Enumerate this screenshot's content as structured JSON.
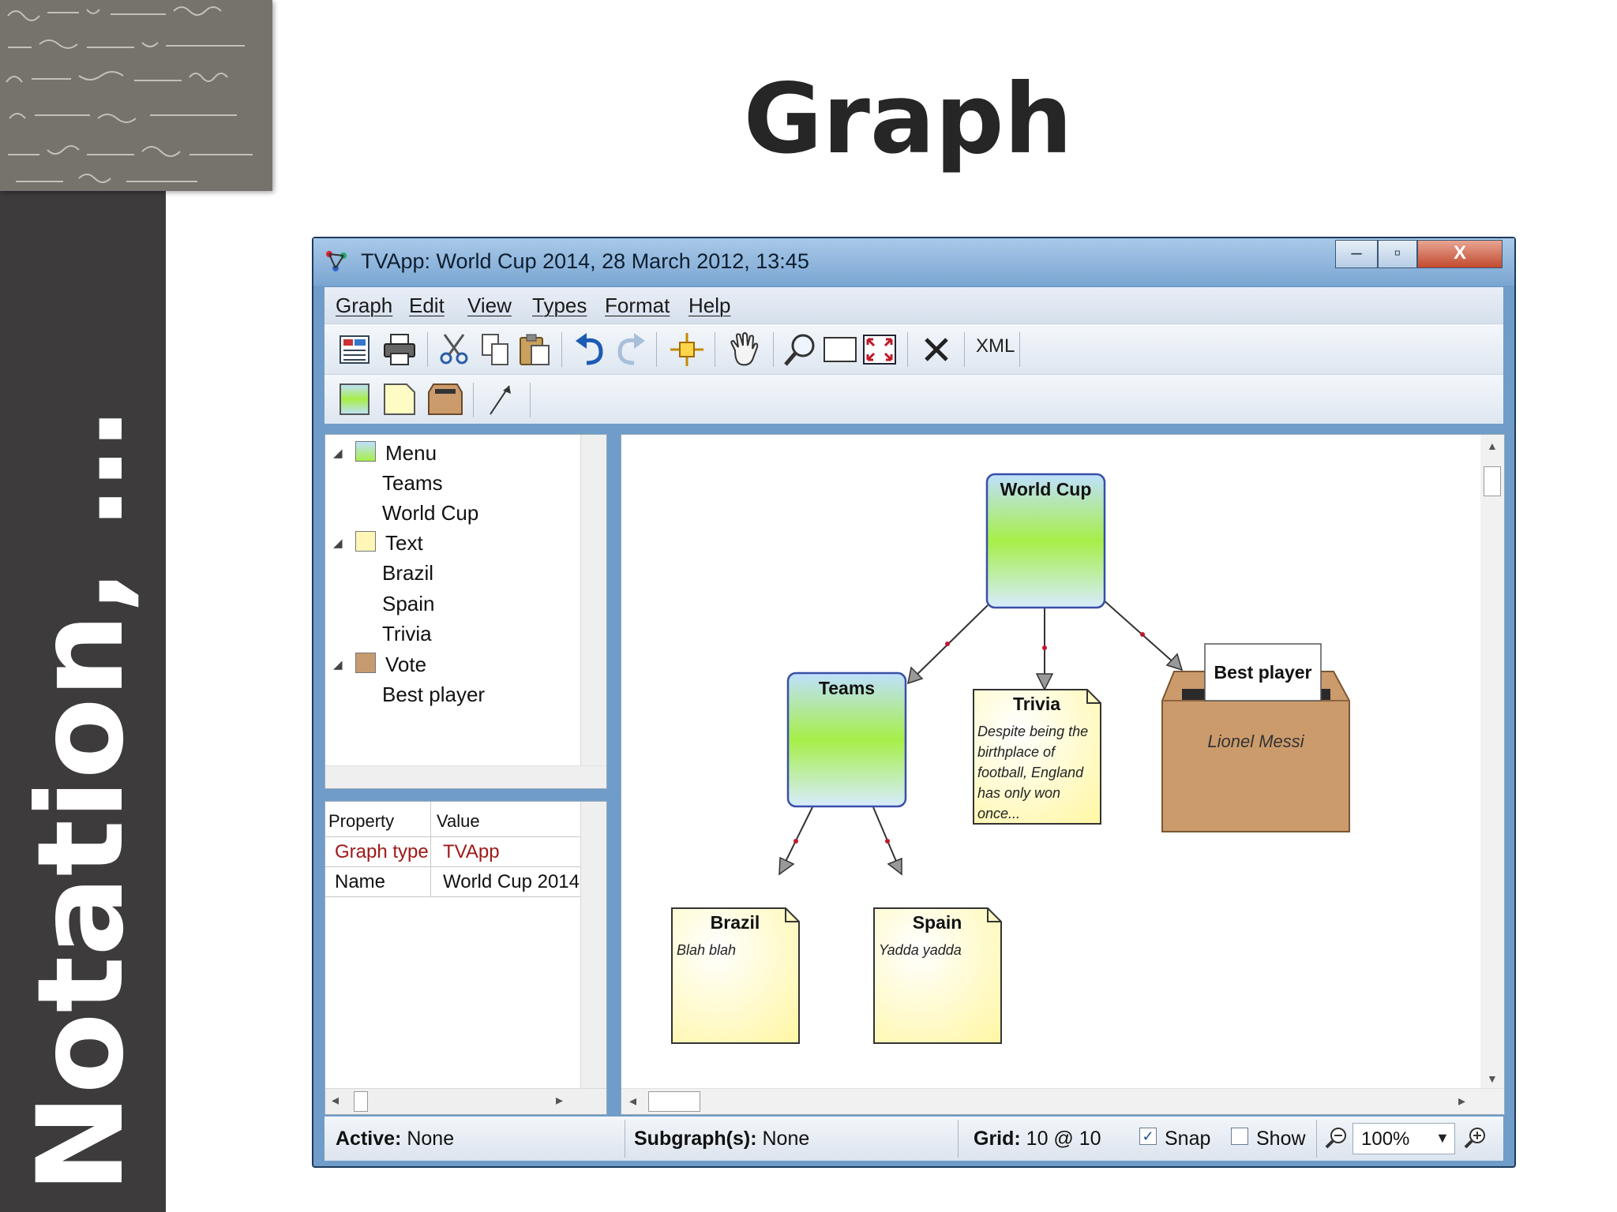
{
  "slide": {
    "title": "Graph",
    "side_title": "Notation, …"
  },
  "window": {
    "title": "TVApp: World Cup 2014, 28 March 2012, 13:45",
    "minimize_glyph": "–",
    "maximize_glyph": "▫",
    "close_glyph": "X"
  },
  "menu": {
    "items": [
      "Graph",
      "Edit",
      "View",
      "Types",
      "Format",
      "Help"
    ]
  },
  "toolbar": {
    "xml_label": "XML",
    "icons": [
      "grid-icon",
      "print-icon",
      "cut-icon",
      "copy-icon",
      "paste-icon",
      "undo-icon",
      "redo-icon",
      "move-icon",
      "pan-hand-icon",
      "zoom-icon",
      "select-rect-icon",
      "fit-icon",
      "delete-icon"
    ],
    "row2_icons": [
      "menu-type-icon",
      "text-type-icon",
      "vote-type-icon",
      "connector-icon"
    ]
  },
  "tree": {
    "groups": [
      {
        "label": "Menu",
        "icon": "menu-type-icon",
        "color": "#9fe06a",
        "children": [
          "Teams",
          "World Cup"
        ]
      },
      {
        "label": "Text",
        "icon": "text-type-icon",
        "color": "#fff6b8",
        "children": [
          "Brazil",
          "Spain",
          "Trivia"
        ]
      },
      {
        "label": "Vote",
        "icon": "vote-type-icon",
        "color": "#c79b70",
        "children": [
          "Best player"
        ]
      }
    ]
  },
  "properties": {
    "headers": [
      "Property",
      "Value"
    ],
    "rows": [
      {
        "property": "Graph type",
        "value": "TVApp",
        "highlight": "#a01818"
      },
      {
        "property": "Name",
        "value": "World Cup 2014",
        "highlight": "#111111"
      }
    ]
  },
  "graph": {
    "nodes": {
      "world_cup": {
        "label": "World Cup",
        "kind": "menu"
      },
      "teams": {
        "label": "Teams",
        "kind": "menu"
      },
      "trivia": {
        "label": "Trivia",
        "kind": "text",
        "body": "Despite being the birthplace of football, England has only won once..."
      },
      "best_player": {
        "label": "Best player",
        "kind": "vote",
        "body": "Lionel Messi"
      },
      "brazil": {
        "label": "Brazil",
        "kind": "text",
        "body": "Blah blah"
      },
      "spain": {
        "label": "Spain",
        "kind": "text",
        "body": "Yadda yadda"
      }
    },
    "edges": [
      [
        "world_cup",
        "teams"
      ],
      [
        "world_cup",
        "trivia"
      ],
      [
        "world_cup",
        "best_player"
      ],
      [
        "teams",
        "brazil"
      ],
      [
        "teams",
        "spain"
      ]
    ],
    "colors": {
      "menu_top": "#bfe0ff",
      "menu_mid": "#a6ef48",
      "text_note": "#fffbc4",
      "vote_box": "#cc9b6c",
      "edge_dot": "#c0182b"
    }
  },
  "status": {
    "active_label": "Active:",
    "active_value": "None",
    "subgraph_label": "Subgraph(s):",
    "subgraph_value": "None",
    "grid_label": "Grid:",
    "grid_value": "10 @ 10",
    "snap_label": "Snap",
    "snap_checked": true,
    "show_label": "Show",
    "show_checked": false,
    "zoom": "100%"
  }
}
